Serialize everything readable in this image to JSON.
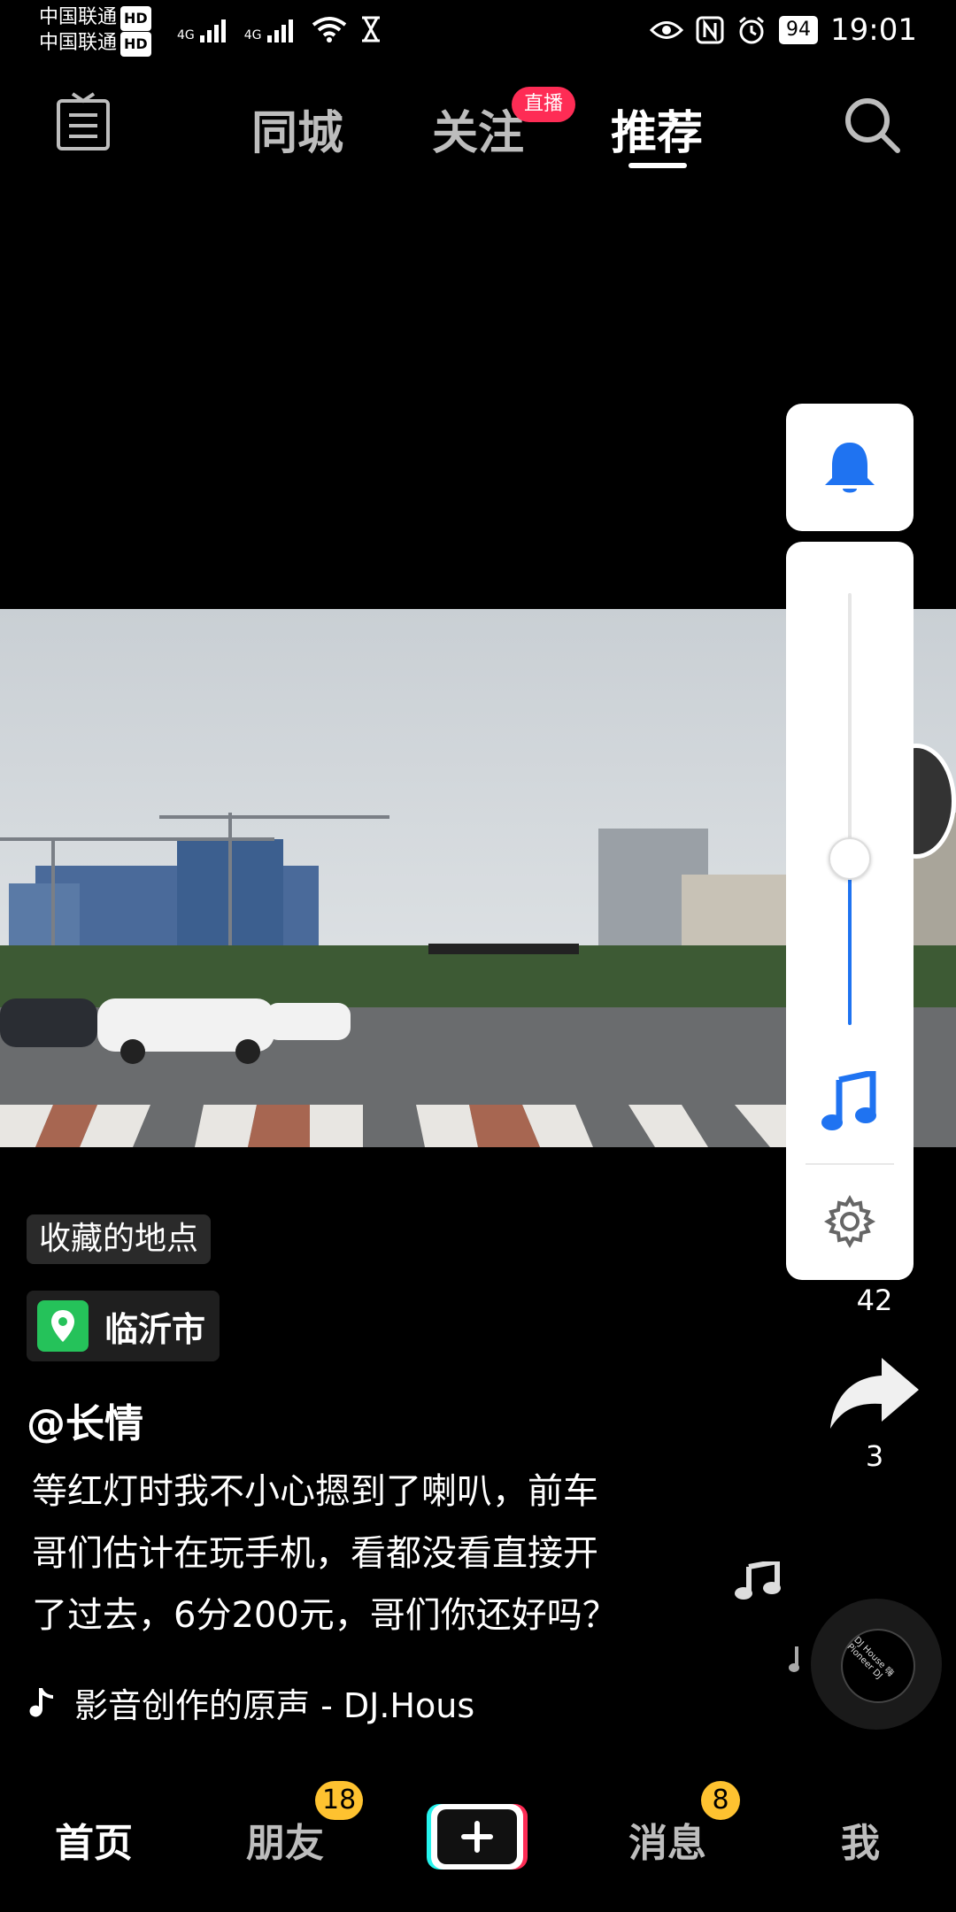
{
  "status_bar": {
    "carrier_1": "中国联通",
    "carrier_2": "中国联通",
    "hd_label": "HD",
    "network_1": "4G",
    "network_2": "4G",
    "battery": "94",
    "time": "19:01",
    "icons": [
      "signal-icon",
      "wifi-icon",
      "hourglass-icon",
      "eye-icon",
      "nfc-icon",
      "alarm-icon",
      "battery-icon"
    ]
  },
  "top_nav": {
    "live_icon_label": "直播",
    "tabs": [
      {
        "label": "同城",
        "active": false
      },
      {
        "label": "关注",
        "active": false
      },
      {
        "label": "推荐",
        "active": true
      }
    ],
    "follow_badge": "直播"
  },
  "volume_panel": {
    "level": 0.39,
    "icons": [
      "bell-icon",
      "music-note-icon",
      "gear-icon"
    ],
    "accent": "#1f73f1"
  },
  "right_rail": {
    "comment_count": "42",
    "share_count": "3"
  },
  "post": {
    "chip_label": "收藏的地点",
    "location": "临沂市",
    "author": "@长情",
    "description_lines": [
      "等红灯时我不小心摁到了喇叭，前车",
      "哥们估计在玩手机，看都没看直接开",
      "了过去，6分200元，哥们你还好吗？"
    ],
    "music": "影音创作的原声 - DJ.Hous",
    "disc_label": "DJ House 嗨 Pioneer DJ"
  },
  "bottom_nav": {
    "items": [
      {
        "label": "首页",
        "active": true
      },
      {
        "label": "朋友",
        "badge": "18"
      },
      {
        "label": "消息",
        "badge": "8"
      },
      {
        "label": "我"
      }
    ],
    "brand_colors": {
      "cyan": "#25f4ee",
      "red": "#fe2c55",
      "badge": "#fec230"
    }
  }
}
